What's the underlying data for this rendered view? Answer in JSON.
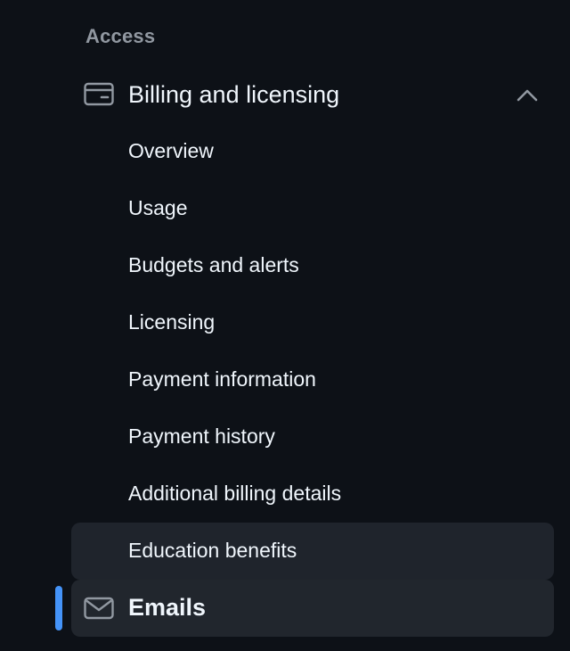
{
  "sidebar": {
    "section_heading": "Access",
    "billing_group": {
      "label": "Billing and licensing",
      "icon": "credit-card-icon",
      "expanded": true,
      "items": [
        {
          "label": "Overview"
        },
        {
          "label": "Usage"
        },
        {
          "label": "Budgets and alerts"
        },
        {
          "label": "Licensing"
        },
        {
          "label": "Payment information"
        },
        {
          "label": "Payment history"
        },
        {
          "label": "Additional billing details"
        },
        {
          "label": "Education benefits"
        }
      ]
    },
    "emails_item": {
      "label": "Emails",
      "icon": "mail-icon",
      "active": true
    }
  },
  "colors": {
    "background": "#0d1117",
    "text": "#f0f6fc",
    "muted": "#9198a1",
    "hover": "#1f242c",
    "active_bg": "#21262d",
    "accent": "#4493f8"
  }
}
